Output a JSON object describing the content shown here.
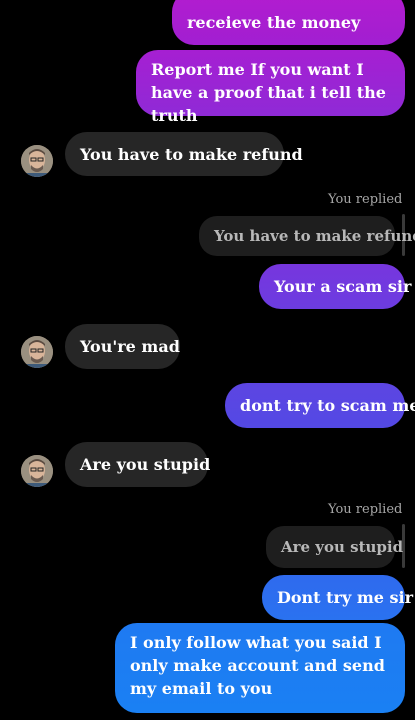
{
  "conversation": {
    "messages": [
      {
        "type": "sent",
        "text": "receieve the money"
      },
      {
        "type": "sent",
        "text": "Report me If you want I have a proof that i tell the truth"
      },
      {
        "type": "received",
        "text": "You have to make refund"
      },
      {
        "type": "reply_label",
        "text": "You replied"
      },
      {
        "type": "quoted",
        "text": "You have to make refund"
      },
      {
        "type": "sent",
        "text": "Your a scam sir"
      },
      {
        "type": "received",
        "text": "You're mad"
      },
      {
        "type": "sent",
        "text": "dont try to scam me"
      },
      {
        "type": "received",
        "text": "Are you stupid"
      },
      {
        "type": "reply_label",
        "text": "You replied"
      },
      {
        "type": "quoted",
        "text": "Are you stupid"
      },
      {
        "type": "sent",
        "text": "Dont try me sir"
      },
      {
        "type": "sent",
        "text": "I only follow what you said I only make account and send my email to you"
      }
    ]
  },
  "colors": {
    "background": "#000000",
    "received_bubble": "#262626",
    "quoted_bubble": "#1e1e1e",
    "sent_top": "#a21fd0",
    "sent_middle": "#6a3ee0",
    "sent_bottom": "#1a7cf2"
  },
  "icons": {
    "contact_avatar": "contact-avatar-icon"
  }
}
